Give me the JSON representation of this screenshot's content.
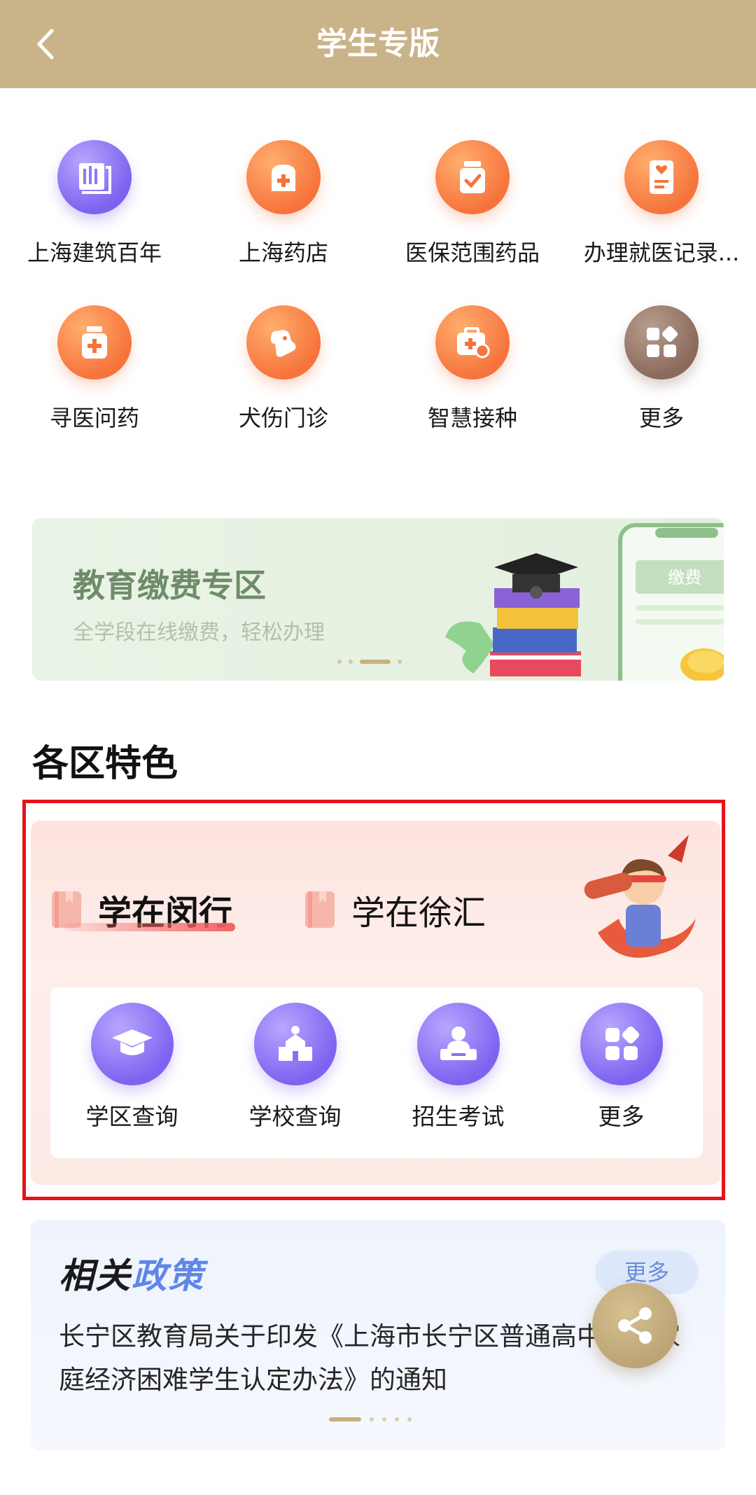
{
  "header": {
    "title": "学生专版",
    "back_icon": "chevron-left-icon"
  },
  "services": {
    "rows": [
      [
        {
          "label": "上海建筑百年",
          "icon": "building-book-icon",
          "color": "purple"
        },
        {
          "label": "上海药店",
          "icon": "pharmacy-icon",
          "color": "orange"
        },
        {
          "label": "医保范围药品",
          "icon": "medicine-jar-icon",
          "color": "orange"
        },
        {
          "label": "办理就医记录...",
          "icon": "medical-record-icon",
          "color": "orange"
        }
      ],
      [
        {
          "label": "寻医问药",
          "icon": "medicine-bottle-icon",
          "color": "orange"
        },
        {
          "label": "犬伤门诊",
          "icon": "dog-icon",
          "color": "orange"
        },
        {
          "label": "智慧接种",
          "icon": "vaccine-kit-icon",
          "color": "orange"
        },
        {
          "label": "更多",
          "icon": "grid-more-icon",
          "color": "brown"
        }
      ]
    ]
  },
  "banner": {
    "title": "教育缴费专区",
    "subtitle": "全学段在线缴费，轻松办理",
    "phone_button": "缴费",
    "dots": 4,
    "active_dot": 2
  },
  "districts": {
    "section_title": "各区特色",
    "tabs": [
      {
        "label": "学在闵行",
        "active": true
      },
      {
        "label": "学在徐汇",
        "active": false
      }
    ],
    "features": [
      {
        "label": "学区查询",
        "icon": "graduation-cap-icon"
      },
      {
        "label": "学校查询",
        "icon": "school-building-icon"
      },
      {
        "label": "招生考试",
        "icon": "exam-desk-icon"
      },
      {
        "label": "更多",
        "icon": "grid-more-icon"
      }
    ]
  },
  "policy": {
    "title_part1": "相关",
    "title_part2": "政策",
    "more_label": "更多",
    "text": "长宁区教育局关于印发《上海市长宁区普通高中其他家庭经济困难学生认定办法》的通知",
    "dots": 5,
    "active_dot": 0
  },
  "colors": {
    "header_bg": "#c9b48a",
    "orange": "#f6743c",
    "purple": "#7c62ee",
    "highlight_border": "#e5141b",
    "policy_accent": "#5f86e8"
  }
}
